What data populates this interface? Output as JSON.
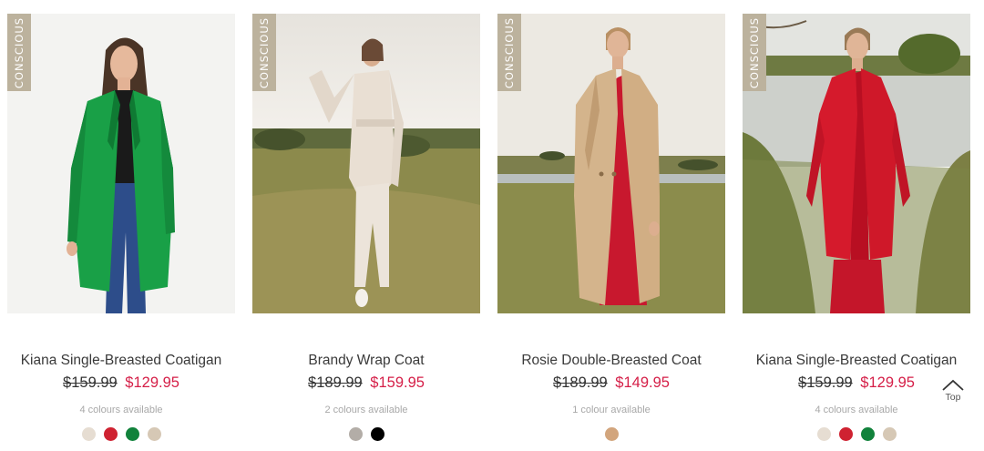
{
  "products": [
    {
      "badge": "CONSCIOUS",
      "name": "Kiana Single-Breasted Coatigan",
      "was_price": "$159.99",
      "now_price": "$129.95",
      "colours": "4 colours available",
      "swatches": [
        "#e6ddd2",
        "#cf2231",
        "#11823b",
        "#d6c8b5"
      ]
    },
    {
      "badge": "CONSCIOUS",
      "name": "Brandy Wrap Coat",
      "was_price": "$189.99",
      "now_price": "$159.95",
      "colours": "2 colours available",
      "swatches": [
        "#b3ada7",
        "#000000"
      ]
    },
    {
      "badge": "CONSCIOUS",
      "name": "Rosie Double-Breasted Coat",
      "was_price": "$189.99",
      "now_price": "$149.95",
      "colours": "1 colour available",
      "swatches": [
        "#d2a57d"
      ]
    },
    {
      "badge": "CONSCIOUS",
      "name": "Kiana Single-Breasted Coatigan",
      "was_price": "$159.99",
      "now_price": "$129.95",
      "colours": "4 colours available",
      "swatches": [
        "#e6ddd2",
        "#cf2231",
        "#11823b",
        "#d6c8b5"
      ]
    }
  ],
  "back_to_top": {
    "label": "Top"
  },
  "colors": {
    "sale": "#d51e47",
    "badge": "#bcb29d"
  }
}
